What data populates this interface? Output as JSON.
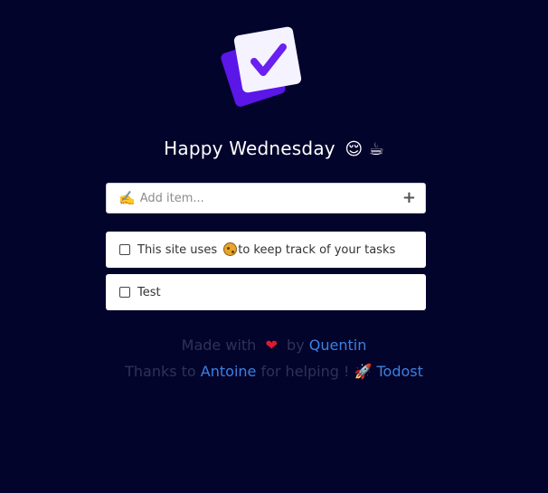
{
  "logo": {
    "icon": "checkbox-cards-logo",
    "colors": {
      "back": "#5b16e8",
      "front": "#f5f3ff",
      "check": "#6a20f0"
    }
  },
  "greeting": {
    "text": "Happy Wednesday",
    "emojis": "😌 ☕"
  },
  "add_item": {
    "icon": "✍️",
    "placeholder": "Add item...",
    "add_icon": "+"
  },
  "todos": [
    {
      "text_before": "This site uses ",
      "icon": "cookie-icon",
      "text_after": "to keep track of your tasks",
      "checked": false
    },
    {
      "text": "Test",
      "checked": false
    }
  ],
  "footer": {
    "made_with": "Made with",
    "heart": "❤",
    "by": "by",
    "author": "Quentin",
    "thanks_to": "Thanks to",
    "helper": "Antoine",
    "for_helping": "for helping !",
    "rocket": "🚀",
    "app_name": "Todost"
  },
  "colors": {
    "background": "#03042b",
    "link": "#3c80e0",
    "muted_text": "#2d3358"
  }
}
